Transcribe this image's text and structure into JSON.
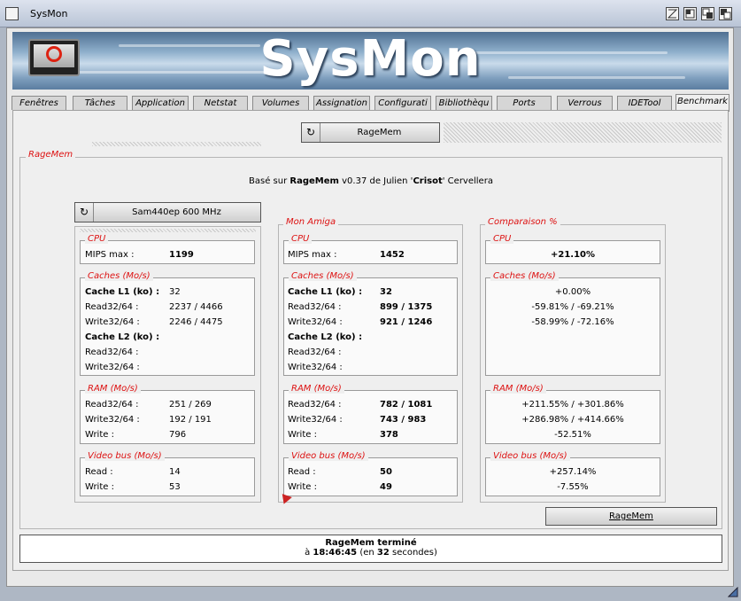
{
  "window": {
    "title": "SysMon"
  },
  "banner": {
    "logo_text": "SysMon"
  },
  "tabs": [
    "Fenêtres",
    "Tâches",
    "Application",
    "Netstat",
    "Volumes",
    "Assignation",
    "Configurati",
    "Bibliothèqu",
    "Ports",
    "Verrous",
    "IDETool",
    "Benchmark"
  ],
  "active_tab": "Benchmark",
  "toolbar": {
    "ragemem_button": "RageMem"
  },
  "group": {
    "label": "RageMem",
    "credit": {
      "prefix": "Basé sur ",
      "name": "RageMem",
      "version": " v0.37 de Julien '",
      "nick": "Crisot",
      "suffix": "' Cervellera"
    }
  },
  "reference": {
    "select_label": "Sam440ep 600 MHz",
    "cpu": {
      "label": "CPU",
      "mips_label": "MIPS max :",
      "mips": "1199"
    },
    "caches": {
      "label": "Caches (Mo/s)",
      "l1_label": "Cache L1 (ko) :",
      "l1": "32",
      "read_label": "Read32/64 :",
      "l1_read": "2237 / 4466",
      "write_label": "Write32/64 :",
      "l1_write": "2246 / 4475",
      "l2_label": "Cache L2 (ko) :",
      "l2_read": "",
      "l2_write": ""
    },
    "ram": {
      "label": "RAM (Mo/s)",
      "read_label": "Read32/64 :",
      "read": "251 / 269",
      "write_label": "Write32/64 :",
      "write": "192 / 191",
      "w_label": "Write :",
      "w": "796"
    },
    "video": {
      "label": "Video bus (Mo/s)",
      "read_label": "Read :",
      "read": "14",
      "write_label": "Write :",
      "write": "53"
    }
  },
  "amiga": {
    "label": "Mon Amiga",
    "cpu": {
      "label": "CPU",
      "mips_label": "MIPS max :",
      "mips": "1452"
    },
    "caches": {
      "label": "Caches (Mo/s)",
      "l1_label": "Cache L1 (ko) :",
      "l1": "32",
      "read_label": "Read32/64 :",
      "l1_read": "899 / 1375",
      "write_label": "Write32/64 :",
      "l1_write": "921 / 1246",
      "l2_label": "Cache L2 (ko) :"
    },
    "ram": {
      "label": "RAM (Mo/s)",
      "read_label": "Read32/64 :",
      "read": "782 / 1081",
      "write_label": "Write32/64 :",
      "write": "743 / 983",
      "w_label": "Write :",
      "w": "378"
    },
    "video": {
      "label": "Video bus (Mo/s)",
      "read_label": "Read :",
      "read": "50",
      "write_label": "Write :",
      "write": "49"
    }
  },
  "comparison": {
    "label": "Comparaison %",
    "cpu": {
      "label": "CPU",
      "mips": "+21.10%"
    },
    "caches": {
      "label": "Caches (Mo/s)",
      "l1": "+0.00%",
      "l1_read": "-59.81% / -69.21%",
      "l1_write": "-58.99% / -72.16%"
    },
    "ram": {
      "label": "RAM (Mo/s)",
      "read": "+211.55% / +301.86%",
      "write": "+286.98% / +414.66%",
      "w": "-52.51%"
    },
    "video": {
      "label": "Video bus (Mo/s)",
      "read": "+257.14%",
      "write": "-7.55%"
    }
  },
  "run_button": "RageMem",
  "status": {
    "line1": "RageMem terminé",
    "prefix": "à ",
    "time": "18:46:45",
    "mid": " (en ",
    "secs": "32",
    "suffix": " secondes)"
  }
}
